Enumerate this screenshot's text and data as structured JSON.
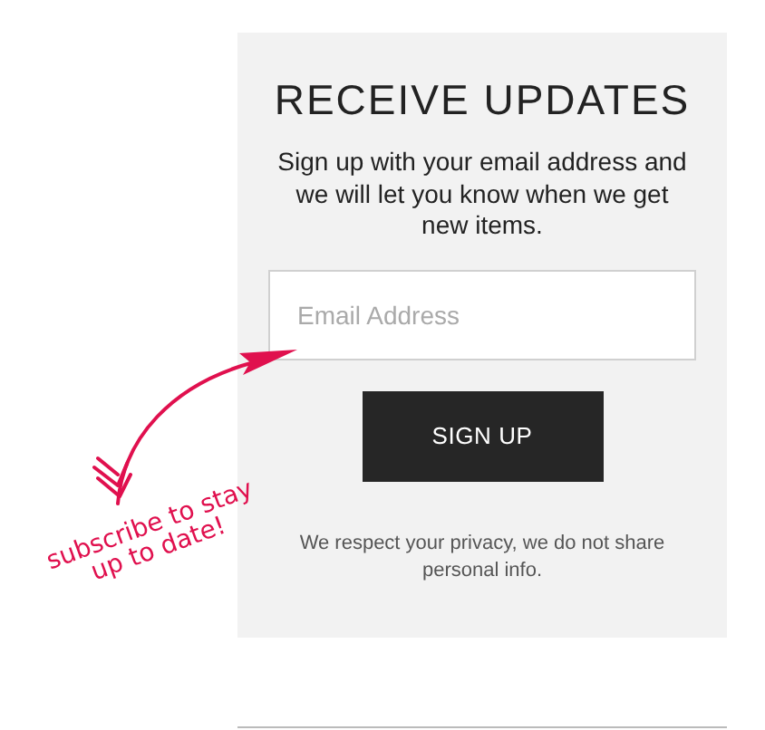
{
  "signup": {
    "title": "RECEIVE UPDATES",
    "description": "Sign up with your email address and we will let you know when we get new items.",
    "email_field": {
      "placeholder": "Email Address"
    },
    "button": "SIGN UP",
    "privacy_note": "We respect your privacy, we do not share personal info."
  },
  "annotation": {
    "lines": [
      "subscribe to stay",
      "up to date!"
    ]
  }
}
